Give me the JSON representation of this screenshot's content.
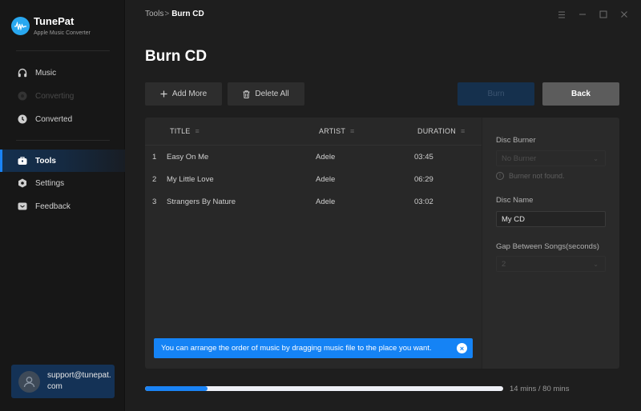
{
  "app": {
    "name": "TunePat",
    "subtitle": "Apple Music Converter"
  },
  "sidebar": {
    "items": [
      {
        "label": "Music",
        "icon": "headphones-icon",
        "state": "normal"
      },
      {
        "label": "Converting",
        "icon": "converting-icon",
        "state": "disabled"
      },
      {
        "label": "Converted",
        "icon": "clock-icon",
        "state": "normal"
      },
      {
        "label": "Tools",
        "icon": "toolbox-icon",
        "state": "active"
      },
      {
        "label": "Settings",
        "icon": "gear-icon",
        "state": "normal"
      },
      {
        "label": "Feedback",
        "icon": "mail-icon",
        "state": "normal"
      }
    ],
    "user": {
      "email": "support@tunepat.com"
    }
  },
  "header": {
    "breadcrumb": {
      "parent": "Tools",
      "separator": ">",
      "current": "Burn CD"
    },
    "window_controls": [
      "menu-icon",
      "minimize-icon",
      "maximize-icon",
      "close-icon"
    ]
  },
  "page": {
    "title": "Burn CD"
  },
  "toolbar": {
    "add_more_label": "Add More",
    "delete_all_label": "Delete All",
    "burn_label": "Burn",
    "back_label": "Back"
  },
  "table": {
    "columns": [
      {
        "label": "TITLE"
      },
      {
        "label": "ARTIST"
      },
      {
        "label": "DURATION"
      }
    ],
    "rows": [
      {
        "index": "1",
        "title": "Easy On Me",
        "artist": "Adele",
        "duration": "03:45"
      },
      {
        "index": "2",
        "title": "My Little Love",
        "artist": "Adele",
        "duration": "06:29"
      },
      {
        "index": "3",
        "title": "Strangers By Nature",
        "artist": "Adele",
        "duration": "03:02"
      }
    ]
  },
  "notice": {
    "text": "You can arrange the order of music by dragging music file to the place you want."
  },
  "settings": {
    "disc_burner_label": "Disc Burner",
    "disc_burner_value": "No Burner",
    "burner_warning": "Burner not found.",
    "disc_name_label": "Disc Name",
    "disc_name_value": "My CD",
    "gap_label": "Gap Between Songs(seconds)",
    "gap_value": "2"
  },
  "progress": {
    "used_minutes": 14,
    "total_minutes": 80,
    "text": "14 mins / 80 mins"
  },
  "colors": {
    "accent": "#1a83f5",
    "sidebar_bg": "#171717",
    "main_bg": "#1e1e1e",
    "panel_bg": "#282828",
    "burn_disabled": "#15304d",
    "back_button": "#5c5c5c"
  }
}
